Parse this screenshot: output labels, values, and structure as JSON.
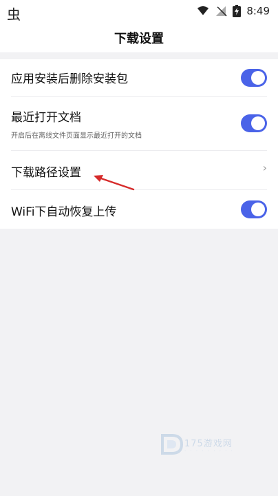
{
  "status_bar": {
    "left_icon": "bug-icon",
    "left_glyph": "虫",
    "time": "8:49",
    "icons": [
      "wifi-icon",
      "signal-off-icon",
      "battery-icon"
    ]
  },
  "header": {
    "title": "下载设置"
  },
  "settings": {
    "items": [
      {
        "title": "应用安装后删除安装包",
        "control": "toggle",
        "enabled": true
      },
      {
        "title": "最近打开文档",
        "subtitle": "开启后在离线文件页面显示最近打开的文档",
        "control": "toggle",
        "enabled": true
      },
      {
        "title": "下载路径设置",
        "control": "chevron",
        "chevron": "›"
      },
      {
        "title": "WiFi下自动恢复上传",
        "control": "toggle",
        "enabled": true
      }
    ]
  },
  "colors": {
    "accent": "#4a63e8",
    "arrow": "#d62b2b"
  },
  "watermark": {
    "text": "175游戏网"
  }
}
